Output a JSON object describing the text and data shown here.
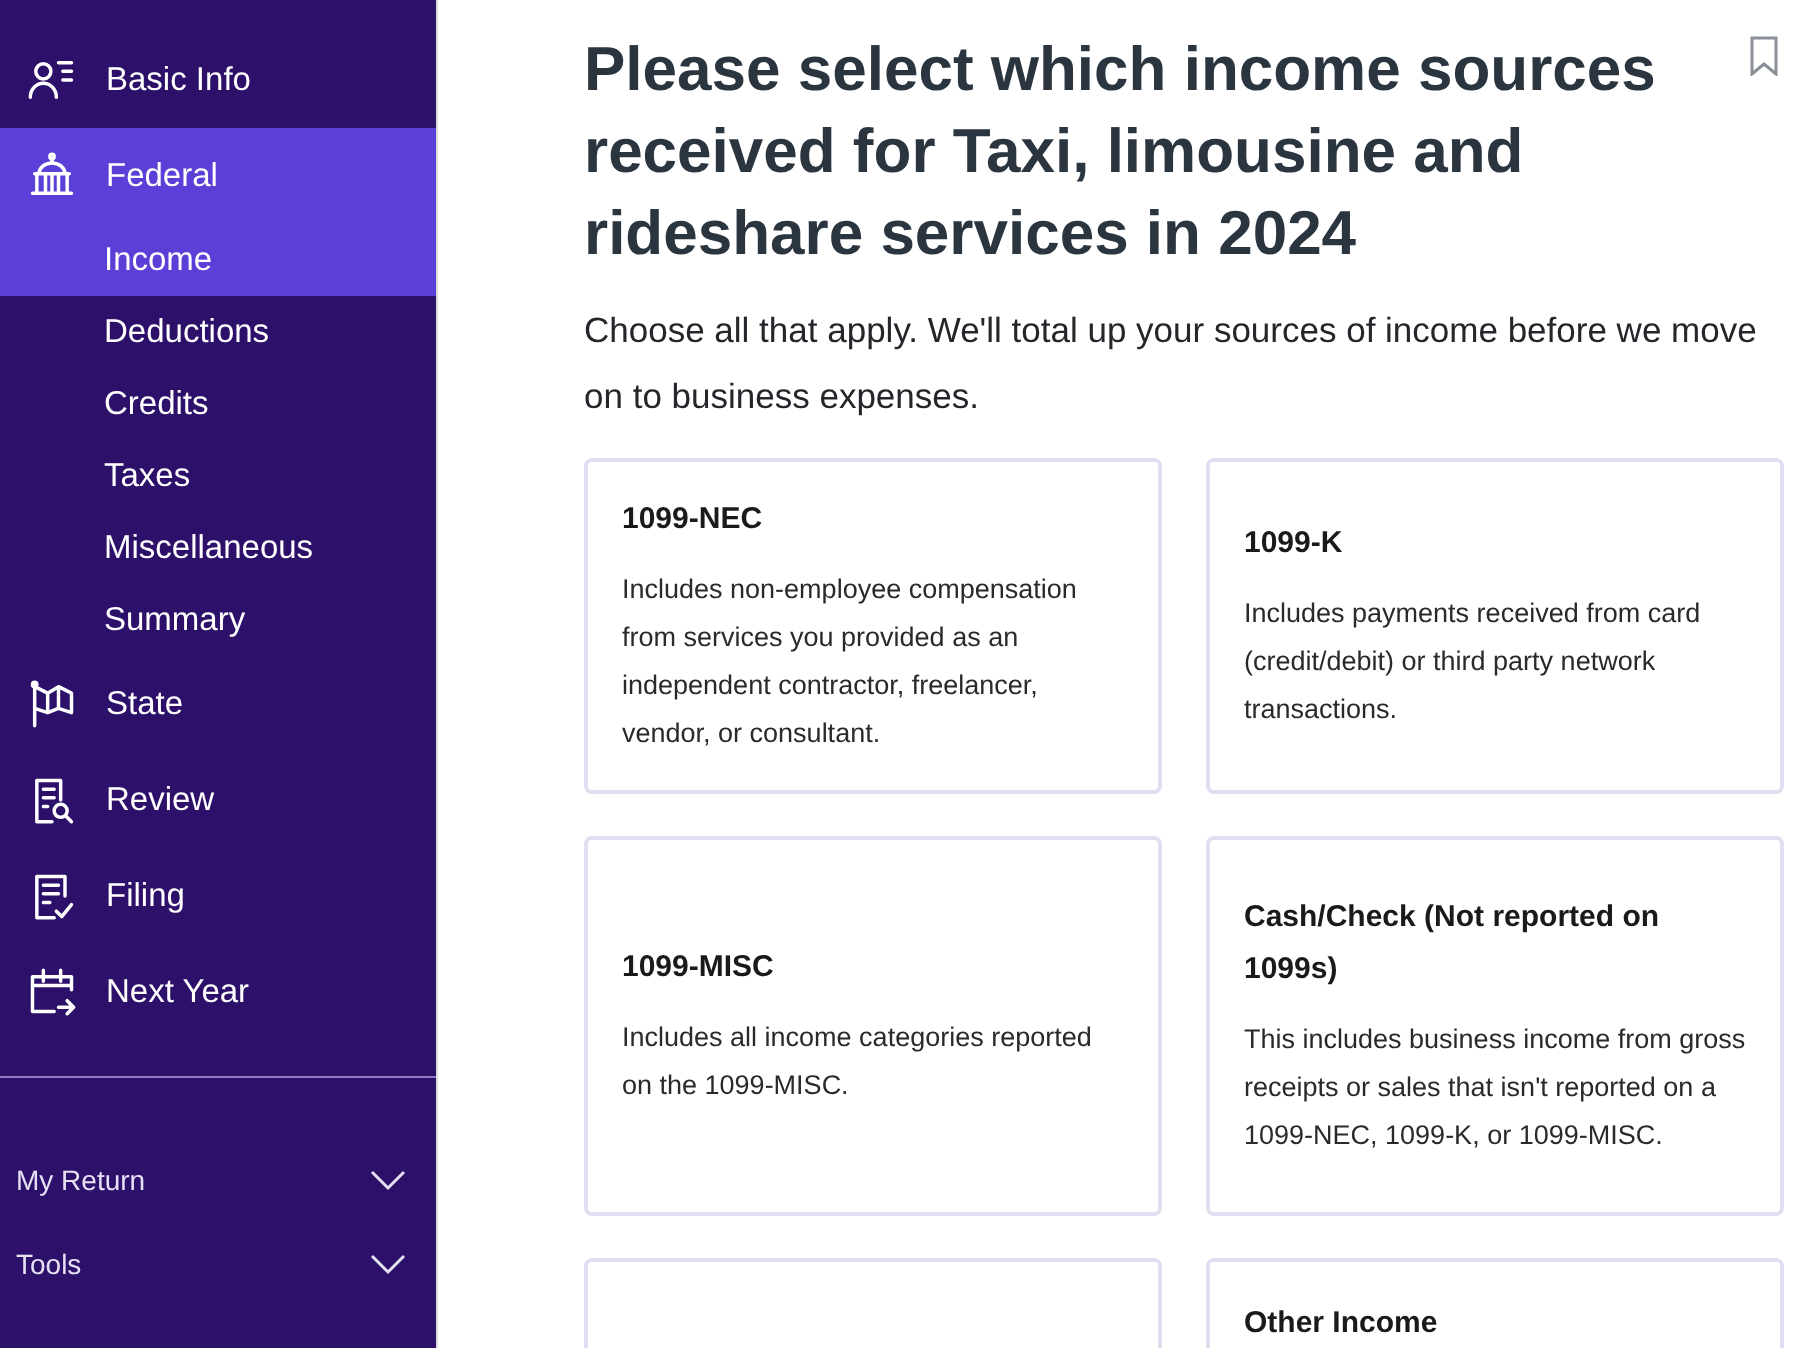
{
  "sidebar": {
    "items": [
      {
        "label": "Basic Info",
        "selected": false
      },
      {
        "label": "Federal",
        "selected": true,
        "children": [
          {
            "label": "Income",
            "selected": true
          },
          {
            "label": "Deductions",
            "selected": false
          },
          {
            "label": "Credits",
            "selected": false
          },
          {
            "label": "Taxes",
            "selected": false
          },
          {
            "label": "Miscellaneous",
            "selected": false
          },
          {
            "label": "Summary",
            "selected": false
          }
        ]
      },
      {
        "label": "State",
        "selected": false
      },
      {
        "label": "Review",
        "selected": false
      },
      {
        "label": "Filing",
        "selected": false
      },
      {
        "label": "Next Year",
        "selected": false
      }
    ],
    "footer": [
      {
        "label": "My Return",
        "expanded": false
      },
      {
        "label": "Tools",
        "expanded": false
      }
    ]
  },
  "main": {
    "title": "Please select which income sources received for Taxi, limousine and rideshare services in 2024",
    "intro": "Choose all that apply. We'll total up your sources of income before we move on to business expenses.",
    "cards": [
      {
        "kind": "text",
        "title": "1099-NEC",
        "description": "Includes non-employee compensation from services you provided as an independent contractor, freelancer, vendor, or consultant."
      },
      {
        "kind": "text",
        "title": "1099-K",
        "description": "Includes payments received from card (credit/debit) or third party network transactions."
      },
      {
        "kind": "text",
        "title": "1099-MISC",
        "description": "Includes all income categories reported on the 1099-MISC."
      },
      {
        "kind": "text",
        "title": "Cash/Check (Not reported on 1099s)",
        "description": "This includes business income from gross receipts or sales that isn't reported on a 1099-NEC, 1099-K, or 1099-MISC."
      },
      {
        "kind": "blank"
      },
      {
        "kind": "text",
        "title": "Other Income"
      }
    ]
  }
}
